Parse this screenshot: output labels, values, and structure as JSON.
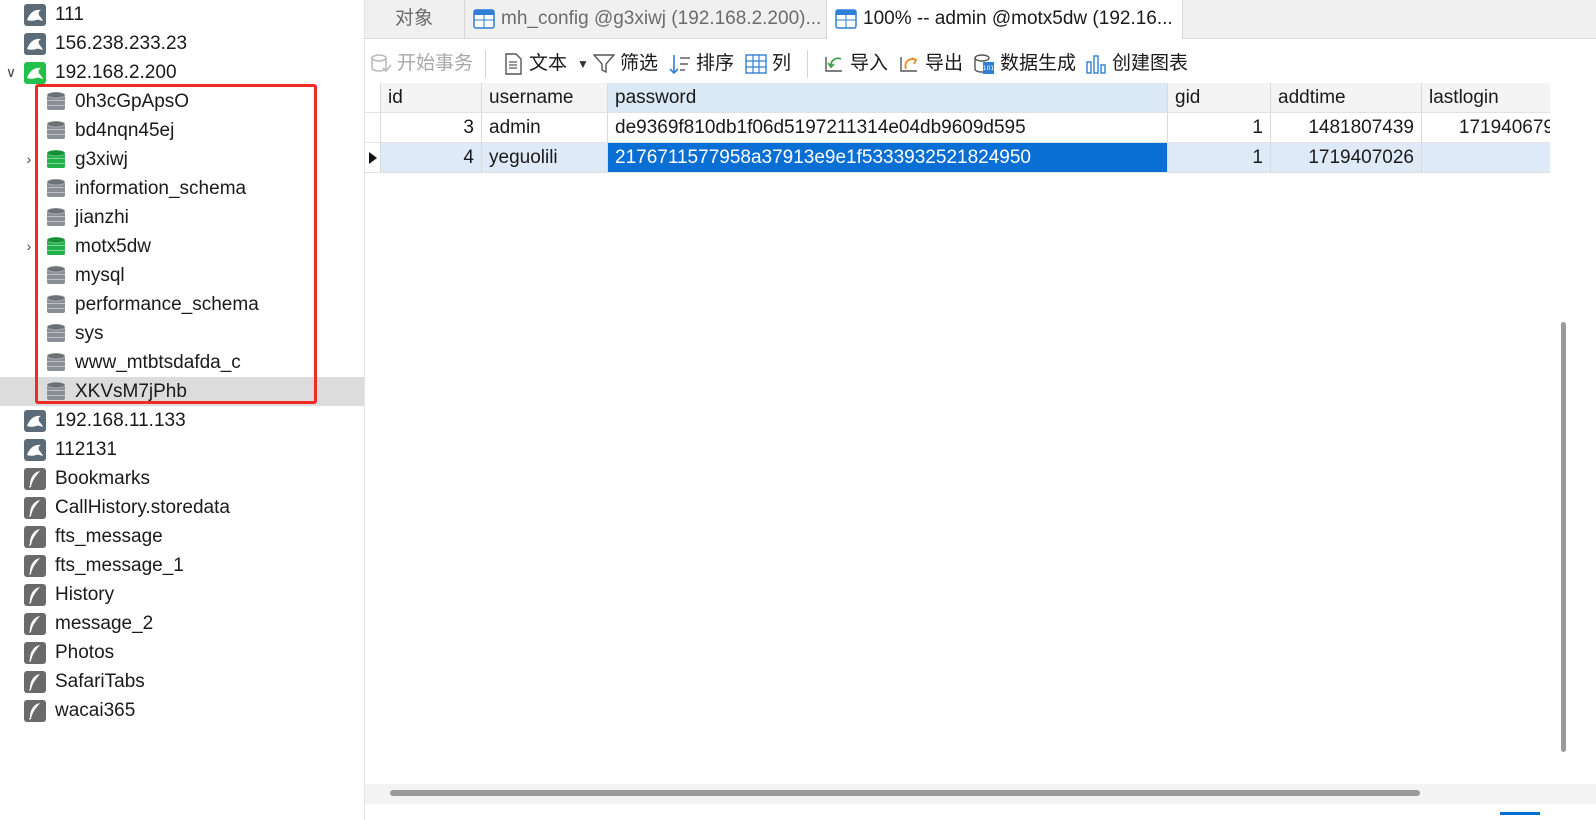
{
  "sidebar": {
    "connections_top": [
      {
        "label": "111",
        "type": "mysql"
      },
      {
        "label": "156.238.233.23",
        "type": "mysql"
      }
    ],
    "active_connection": {
      "label": "192.168.2.200",
      "type": "mysql"
    },
    "databases": [
      {
        "label": "0h3cGpApsO",
        "open": false
      },
      {
        "label": "bd4nqn45ej",
        "open": false
      },
      {
        "label": "g3xiwj",
        "open": true
      },
      {
        "label": "information_schema",
        "open": false
      },
      {
        "label": "jianzhi",
        "open": false
      },
      {
        "label": "motx5dw",
        "open": true
      },
      {
        "label": "mysql",
        "open": false
      },
      {
        "label": "performance_schema",
        "open": false
      },
      {
        "label": "sys",
        "open": false
      },
      {
        "label": "www_mtbtsdafda_c",
        "open": false
      },
      {
        "label": "XKVsM7jPhb",
        "open": false
      }
    ],
    "connections_bottom": [
      {
        "label": "192.168.11.133",
        "type": "mysql"
      },
      {
        "label": "112131",
        "type": "mysql"
      },
      {
        "label": "Bookmarks",
        "type": "sqlite"
      },
      {
        "label": "CallHistory.storedata",
        "type": "sqlite"
      },
      {
        "label": "fts_message",
        "type": "sqlite"
      },
      {
        "label": "fts_message_1",
        "type": "sqlite"
      },
      {
        "label": "History",
        "type": "sqlite"
      },
      {
        "label": "message_2",
        "type": "sqlite"
      },
      {
        "label": "Photos",
        "type": "sqlite"
      },
      {
        "label": "SafariTabs",
        "type": "sqlite"
      },
      {
        "label": "wacai365",
        "type": "sqlite"
      }
    ]
  },
  "tabs": [
    {
      "label": "对象",
      "active": false
    },
    {
      "label": "mh_config @g3xiwj (192.168.2.200)...",
      "active": false
    },
    {
      "label": "100% -- admin @motx5dw (192.16...",
      "active": true
    }
  ],
  "toolbar": {
    "begin_transaction": "开始事务",
    "text": "文本",
    "filter": "筛选",
    "sort": "排序",
    "columns": "列",
    "import": "导入",
    "export": "导出",
    "data_generation": "数据生成",
    "create_chart": "创建图表"
  },
  "grid": {
    "columns": [
      "id",
      "username",
      "password",
      "gid",
      "addtime",
      "lastlogin"
    ],
    "rows": [
      [
        "3",
        "admin",
        "de9369f810db1f06d5197211314e04db9609d595",
        "1",
        "1481807439",
        "171940679"
      ],
      [
        "4",
        "yeguolili",
        "2176711577958a37913e9e1f5333932521824950",
        "1",
        "1719407026",
        ""
      ]
    ]
  },
  "colors": {
    "accent": "#0a6fd4",
    "highlight_box": "#ee2b24",
    "active_db": "#23c04b"
  }
}
